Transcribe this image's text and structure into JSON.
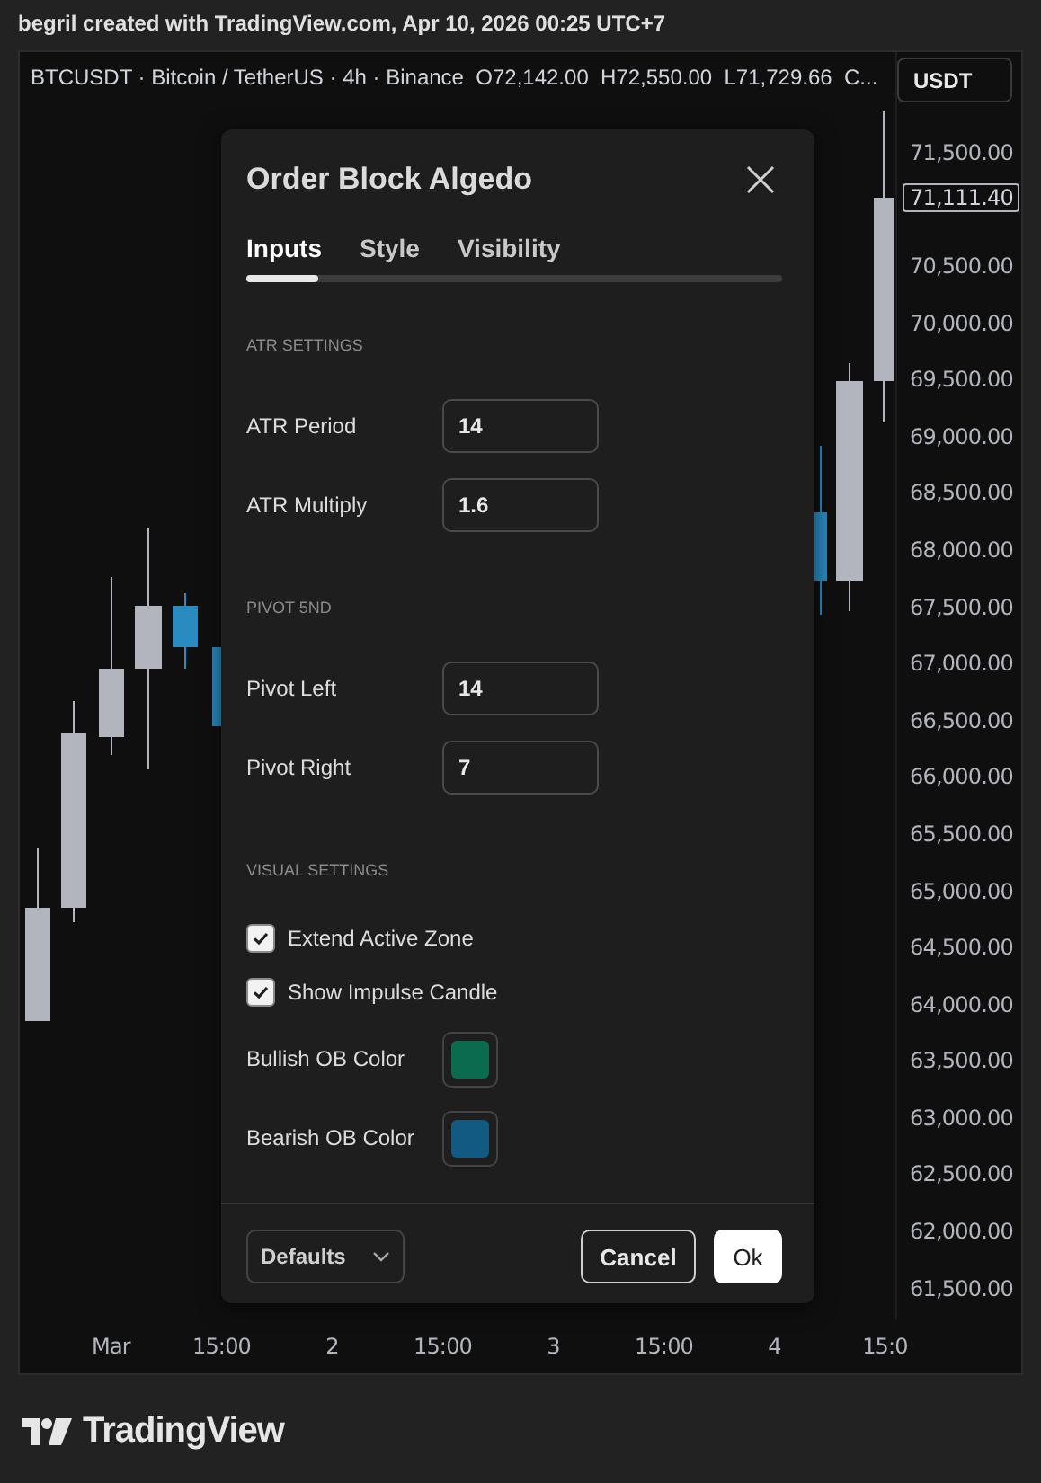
{
  "attribution": "begril created with TradingView.com, Apr 10, 2026 00:25 UTC+7",
  "chart": {
    "symbol_info": "BTCUSDT · Bitcoin / TetherUS · 4h · Binance  O72,142.00  H72,550.00  L71,729.66  C...",
    "currency_button": "USDT",
    "price_axis": [
      {
        "kind": "tick",
        "label": "71,500.00"
      },
      {
        "kind": "current",
        "label": "71,111.40"
      },
      {
        "kind": "tick",
        "label": "70,500.00"
      },
      {
        "kind": "tick",
        "label": "70,000.00"
      },
      {
        "kind": "tick",
        "label": "69,500.00"
      },
      {
        "kind": "tick",
        "label": "69,000.00"
      },
      {
        "kind": "tick",
        "label": "68,500.00"
      },
      {
        "kind": "tick",
        "label": "68,000.00"
      },
      {
        "kind": "tick",
        "label": "67,500.00"
      },
      {
        "kind": "tick",
        "label": "67,000.00"
      },
      {
        "kind": "tick",
        "label": "66,500.00"
      },
      {
        "kind": "tick",
        "label": "66,000.00"
      },
      {
        "kind": "tick",
        "label": "65,500.00"
      },
      {
        "kind": "tick",
        "label": "65,000.00"
      },
      {
        "kind": "tick",
        "label": "64,500.00"
      },
      {
        "kind": "tick",
        "label": "64,000.00"
      },
      {
        "kind": "tick",
        "label": "63,500.00"
      },
      {
        "kind": "tick",
        "label": "63,000.00"
      },
      {
        "kind": "tick",
        "label": "62,500.00"
      },
      {
        "kind": "tick",
        "label": "62,000.00"
      },
      {
        "kind": "tick",
        "label": "61,500.00"
      }
    ],
    "time_axis": [
      "Mar",
      "15:00",
      "2",
      "15:00",
      "3",
      "15:00",
      "4",
      "15:0"
    ]
  },
  "dialog": {
    "title": "Order Block Algedo",
    "tabs": [
      {
        "label": "Inputs",
        "selected": true
      },
      {
        "label": "Style",
        "selected": false
      },
      {
        "label": "Visibility",
        "selected": false
      }
    ],
    "sections": [
      {
        "heading": "ATR SETTINGS",
        "rows": [
          {
            "kind": "number",
            "label": "ATR Period",
            "value": "14"
          },
          {
            "kind": "number",
            "label": "ATR Multiply",
            "value": "1.6"
          }
        ]
      },
      {
        "heading": "PIVOT 5ND",
        "rows": [
          {
            "kind": "number",
            "label": "Pivot Left",
            "value": "14"
          },
          {
            "kind": "number",
            "label": "Pivot Right",
            "value": "7"
          }
        ]
      },
      {
        "heading": "VISUAL SETTINGS",
        "rows": [
          {
            "kind": "checkbox",
            "label": "Extend Active Zone",
            "checked": true
          },
          {
            "kind": "checkbox",
            "label": "Show Impulse Candle",
            "checked": true
          },
          {
            "kind": "color",
            "label": "Bullish OB Color",
            "color": "#0b6b4f"
          },
          {
            "kind": "color",
            "label": "Bearish OB Color",
            "color": "#135a83"
          }
        ]
      }
    ],
    "defaults_button": "Defaults",
    "cancel_button": "Cancel",
    "ok_button": "Ok"
  },
  "brand": "TradingView"
}
